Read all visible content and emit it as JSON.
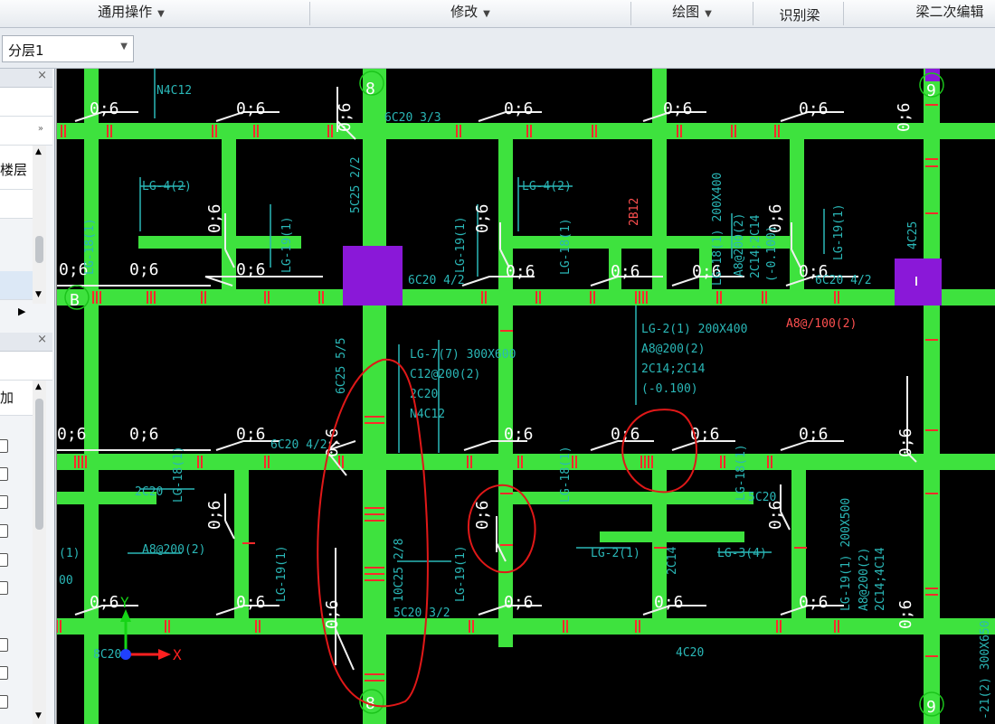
{
  "menu": {
    "general_ops": "通用操作",
    "modify": "修改",
    "draw": "绘图",
    "identify_beam": "识别梁",
    "beam_secondary_edit": "梁二次编辑"
  },
  "toolbar": {
    "layer_select": "分层1"
  },
  "left_panel": {
    "floor_label": "楼层",
    "add_label": "加"
  },
  "canvas": {
    "axis_labels": {
      "b": "B",
      "top8": "8",
      "top9": "9",
      "bot8": "8",
      "bot9": "9"
    },
    "offset_text": "0;6",
    "axis_x": "X",
    "axis_y": "Y",
    "annotations": {
      "n4c12_top": "N4C12",
      "c6_203_3": "6C20 3/3",
      "c5_25_2_2": "5C25 2/2",
      "lg4_left": "LG-4(2)",
      "lg19_1": "LG-19(1)",
      "lg19_2": "LG-19(1)",
      "lg4_right": "LG-4(2)",
      "b12": "2B12",
      "lg18_beam": "LG-18(1) 200X400",
      "a8_200_2": "A8@200(2)",
      "c14c14": "2C14;2C14",
      "minus100": "(-0.100)",
      "lg19_3": "LG-19(1)",
      "c4c25": "4C25",
      "c6_204_2": "6C20 4/2",
      "c6_204_2b": "6C20 4/2",
      "lg18_1": "LG-18(1)",
      "lg18_a": "LG-18(1)",
      "lg2_main": "LG-2(1) 200X400",
      "lg2_a8": "A8@200(2)",
      "lg2_2c14": "2C14;2C14",
      "lg2_minus": "(-0.100)",
      "a8_100_2": "A8@/100(2)",
      "lg7": "LG-7(7) 300X600",
      "c12_200": "C12@200(2)",
      "c2c20": "2C20",
      "n4c12": "N4C12",
      "c25_55": "6C25 5/5",
      "c6_20_4": "6C20 4/2",
      "lg18_b": "LG-18(1)",
      "c2c20b": "2C20",
      "a8_200b": "A8@200(2)",
      "lg19_4": "LG-19(1)",
      "c10_25": "10C25 2/8",
      "lg19_5": "LG-19(1)",
      "c5c20": "5C20 3/2",
      "lg18_c": "LG-18(1)",
      "lg2_b": "LG-2(1)",
      "c2c14": "2C14",
      "lg3": "LG-3(4)",
      "c5c20b": "5C20",
      "lg18_d": "LG-18(1)",
      "lg19_500": "LG-19(1) 200X500",
      "a8_200c": "A8@200(2)",
      "c14_4": "2C14;4C14",
      "c4c20": "4C20",
      "c8c20": "8C20",
      "lg21": "-21(2) 300X650",
      "lg1_00": "00",
      "lg1_paren": "(1)"
    }
  }
}
